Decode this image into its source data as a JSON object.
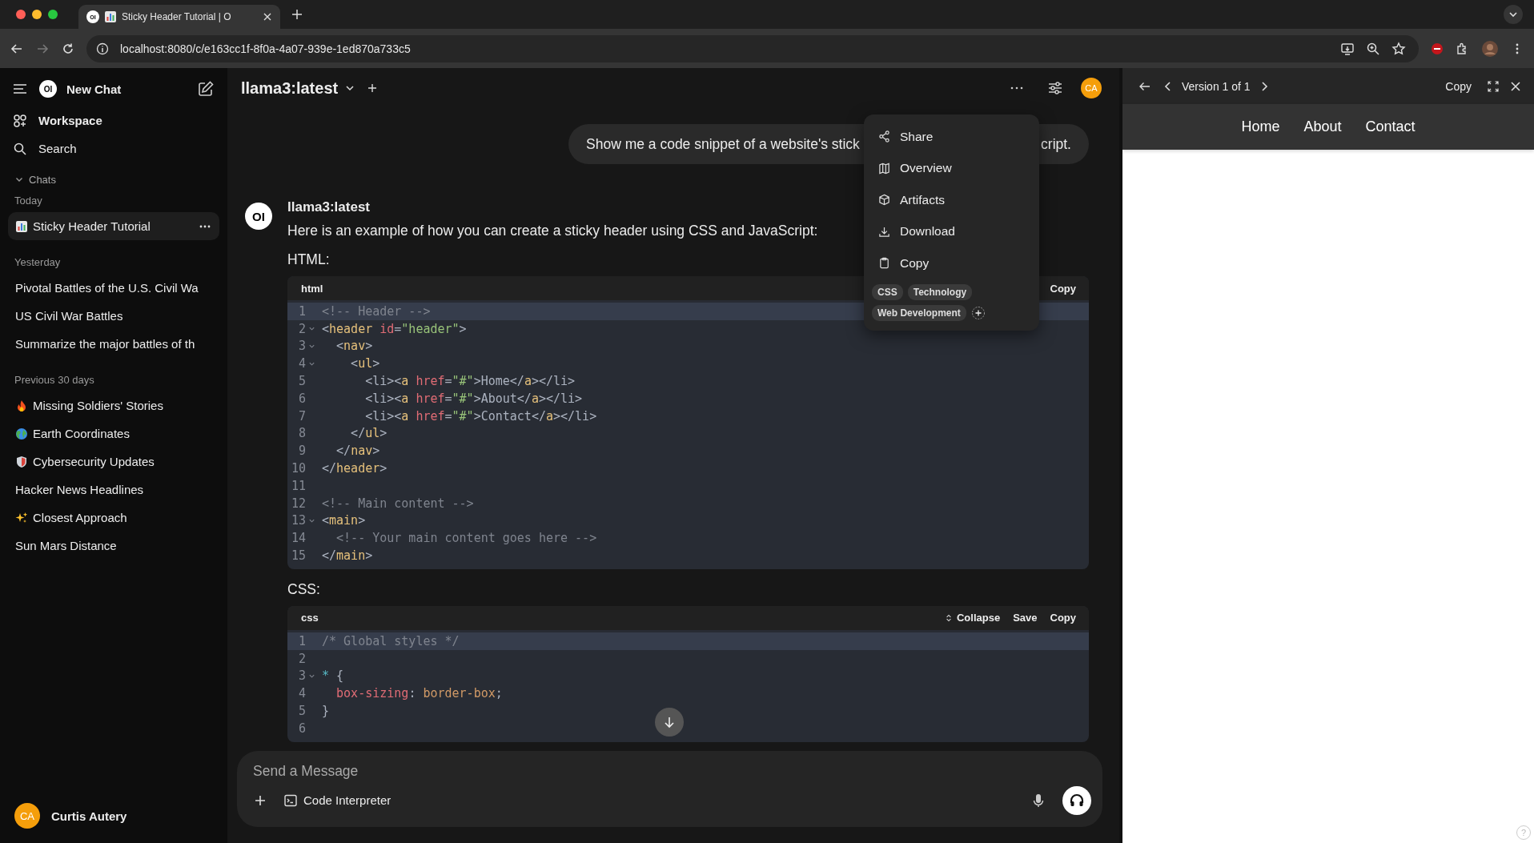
{
  "browser": {
    "tab": {
      "favicon_text": "OI",
      "title": "Sticky Header Tutorial | O"
    },
    "url": "localhost:8080/c/e163cc1f-8f0a-4a07-939e-1ed870a733c5"
  },
  "sidebar": {
    "logo_text": "OI",
    "new_chat": "New Chat",
    "workspace": "Workspace",
    "search": "Search",
    "chats_label": "Chats",
    "chats_expanded": true,
    "groups": [
      {
        "label": "Today",
        "items": [
          {
            "title": "Sticky Header Tutorial",
            "kind": "chart",
            "selected": true
          }
        ]
      },
      {
        "label": "Yesterday",
        "items": [
          {
            "title": "Pivotal Battles of the U.S. Civil Wa",
            "selected": false
          },
          {
            "title": "US Civil War Battles",
            "selected": false
          },
          {
            "title": "Summarize the major battles of th",
            "selected": false
          }
        ]
      },
      {
        "label": "Previous 30 days",
        "items": [
          {
            "title": "Missing Soldiers' Stories",
            "kind": "fire",
            "selected": false
          },
          {
            "title": "Earth Coordinates",
            "kind": "globe",
            "selected": false
          },
          {
            "title": "Cybersecurity Updates",
            "kind": "shield",
            "selected": false
          },
          {
            "title": "Hacker News Headlines",
            "selected": false
          },
          {
            "title": "Closest Approach",
            "kind": "sparkles",
            "selected": false
          },
          {
            "title": "Sun Mars Distance",
            "selected": false
          }
        ]
      }
    ],
    "user": {
      "initials": "CA",
      "name": "Curtis Autery"
    }
  },
  "chat": {
    "model": "llama3:latest",
    "avatar": "CA",
    "user_message": {
      "start": "Show me a code snippet of a website's stick",
      "end": "cript."
    },
    "reply": {
      "avatar_text": "OI",
      "model": "llama3:latest",
      "intro": "Here is an example of how you can create a sticky header using CSS and JavaScript:",
      "blocks": [
        {
          "label": "HTML:",
          "language": "html",
          "actions": [
            {
              "label": "Copy",
              "kind": "plain"
            }
          ],
          "lines": [
            {
              "n": "1",
              "fold": false,
              "active": true,
              "tokens": [
                {
                  "kind": "comment",
                  "text": "<!-- Header -->"
                }
              ]
            },
            {
              "n": "2",
              "fold": true,
              "active": false,
              "tokens": [
                {
                  "kind": "punct",
                  "text": "<"
                },
                {
                  "kind": "tag",
                  "text": "header"
                },
                {
                  "kind": "attr",
                  "text": " id"
                },
                {
                  "kind": "punct",
                  "text": "="
                },
                {
                  "kind": "string",
                  "text": "\"header\""
                },
                {
                  "kind": "punct",
                  "text": ">"
                }
              ]
            },
            {
              "n": "3",
              "fold": true,
              "active": false,
              "tokens": [
                {
                  "kind": "punct",
                  "text": "  <"
                },
                {
                  "kind": "tag",
                  "text": "nav"
                },
                {
                  "kind": "punct",
                  "text": ">"
                }
              ]
            },
            {
              "n": "4",
              "fold": true,
              "active": false,
              "tokens": [
                {
                  "kind": "punct",
                  "text": "    <"
                },
                {
                  "kind": "tag",
                  "text": "ul"
                },
                {
                  "kind": "punct",
                  "text": ">"
                }
              ]
            },
            {
              "n": "5",
              "fold": false,
              "active": false,
              "tokens": [
                {
                  "kind": "punct",
                  "text": "      <li><"
                },
                {
                  "kind": "tag",
                  "text": "a"
                },
                {
                  "kind": "attr",
                  "text": " href"
                },
                {
                  "kind": "punct",
                  "text": "="
                },
                {
                  "kind": "string",
                  "text": "\"#\""
                },
                {
                  "kind": "punct",
                  "text": ">Home</"
                },
                {
                  "kind": "tag",
                  "text": "a"
                },
                {
                  "kind": "punct",
                  "text": "></li>"
                }
              ]
            },
            {
              "n": "6",
              "fold": false,
              "active": false,
              "tokens": [
                {
                  "kind": "punct",
                  "text": "      <li><"
                },
                {
                  "kind": "tag",
                  "text": "a"
                },
                {
                  "kind": "attr",
                  "text": " href"
                },
                {
                  "kind": "punct",
                  "text": "="
                },
                {
                  "kind": "string",
                  "text": "\"#\""
                },
                {
                  "kind": "punct",
                  "text": ">About</"
                },
                {
                  "kind": "tag",
                  "text": "a"
                },
                {
                  "kind": "punct",
                  "text": "></li>"
                }
              ]
            },
            {
              "n": "7",
              "fold": false,
              "active": false,
              "tokens": [
                {
                  "kind": "punct",
                  "text": "      <li><"
                },
                {
                  "kind": "tag",
                  "text": "a"
                },
                {
                  "kind": "attr",
                  "text": " href"
                },
                {
                  "kind": "punct",
                  "text": "="
                },
                {
                  "kind": "string",
                  "text": "\"#\""
                },
                {
                  "kind": "punct",
                  "text": ">Contact</"
                },
                {
                  "kind": "tag",
                  "text": "a"
                },
                {
                  "kind": "punct",
                  "text": "></li>"
                }
              ]
            },
            {
              "n": "8",
              "fold": false,
              "active": false,
              "tokens": [
                {
                  "kind": "punct",
                  "text": "    </"
                },
                {
                  "kind": "tag",
                  "text": "ul"
                },
                {
                  "kind": "punct",
                  "text": ">"
                }
              ]
            },
            {
              "n": "9",
              "fold": false,
              "active": false,
              "tokens": [
                {
                  "kind": "punct",
                  "text": "  </"
                },
                {
                  "kind": "tag",
                  "text": "nav"
                },
                {
                  "kind": "punct",
                  "text": ">"
                }
              ]
            },
            {
              "n": "10",
              "fold": false,
              "active": false,
              "tokens": [
                {
                  "kind": "punct",
                  "text": "</"
                },
                {
                  "kind": "tag",
                  "text": "header"
                },
                {
                  "kind": "punct",
                  "text": ">"
                }
              ]
            },
            {
              "n": "11",
              "fold": false,
              "active": false
            },
            {
              "n": "12",
              "fold": false,
              "active": false,
              "tokens": [
                {
                  "kind": "comment",
                  "text": "<!-- Main content -->"
                }
              ]
            },
            {
              "n": "13",
              "fold": true,
              "active": false,
              "tokens": [
                {
                  "kind": "punct",
                  "text": "<"
                },
                {
                  "kind": "tag",
                  "text": "main"
                },
                {
                  "kind": "punct",
                  "text": ">"
                }
              ]
            },
            {
              "n": "14",
              "fold": false,
              "active": false,
              "tokens": [
                {
                  "kind": "comment",
                  "text": "  <!-- Your main content goes here -->"
                }
              ]
            },
            {
              "n": "15",
              "fold": false,
              "active": false,
              "tokens": [
                {
                  "kind": "punct",
                  "text": "</"
                },
                {
                  "kind": "tag",
                  "text": "main"
                },
                {
                  "kind": "punct",
                  "text": ">"
                }
              ]
            }
          ]
        },
        {
          "label": "CSS:",
          "language": "css",
          "actions": [
            {
              "label": "Collapse",
              "kind": "collapse"
            },
            {
              "label": "Save",
              "kind": "plain"
            },
            {
              "label": "Copy",
              "kind": "plain"
            }
          ],
          "lines": [
            {
              "n": "1",
              "fold": false,
              "active": true,
              "tokens": [
                {
                  "kind": "comment",
                  "text": "/* Global styles */"
                }
              ]
            },
            {
              "n": "2",
              "fold": false,
              "active": false
            },
            {
              "n": "3",
              "fold": true,
              "active": false,
              "tokens": [
                {
                  "kind": "selector",
                  "text": "*"
                },
                {
                  "kind": "punct",
                  "text": " {"
                }
              ]
            },
            {
              "n": "4",
              "fold": false,
              "active": false,
              "tokens": [
                {
                  "kind": "property",
                  "text": "  box-sizing"
                },
                {
                  "kind": "punct",
                  "text": ": "
                },
                {
                  "kind": "value",
                  "text": "border-box"
                },
                {
                  "kind": "punct",
                  "text": ";"
                }
              ]
            },
            {
              "n": "5",
              "fold": false,
              "active": false,
              "tokens": [
                {
                  "kind": "punct",
                  "text": "}"
                }
              ]
            },
            {
              "n": "6",
              "fold": false,
              "active": false
            }
          ]
        }
      ]
    },
    "input": {
      "placeholder": "Send a Message",
      "tool": "Code Interpreter"
    }
  },
  "menu": {
    "items": [
      {
        "label": "Share",
        "kind": "share"
      },
      {
        "label": "Overview",
        "kind": "map"
      },
      {
        "label": "Artifacts",
        "kind": "cube"
      },
      {
        "label": "Download",
        "kind": "download"
      },
      {
        "label": "Copy",
        "kind": "clipboard"
      }
    ],
    "tags": [
      "CSS",
      "Technology",
      "Web Development"
    ]
  },
  "artifact": {
    "version": "Version 1 of 1",
    "copy": "Copy",
    "nav": [
      "Home",
      "About",
      "Contact"
    ]
  },
  "help": "?"
}
